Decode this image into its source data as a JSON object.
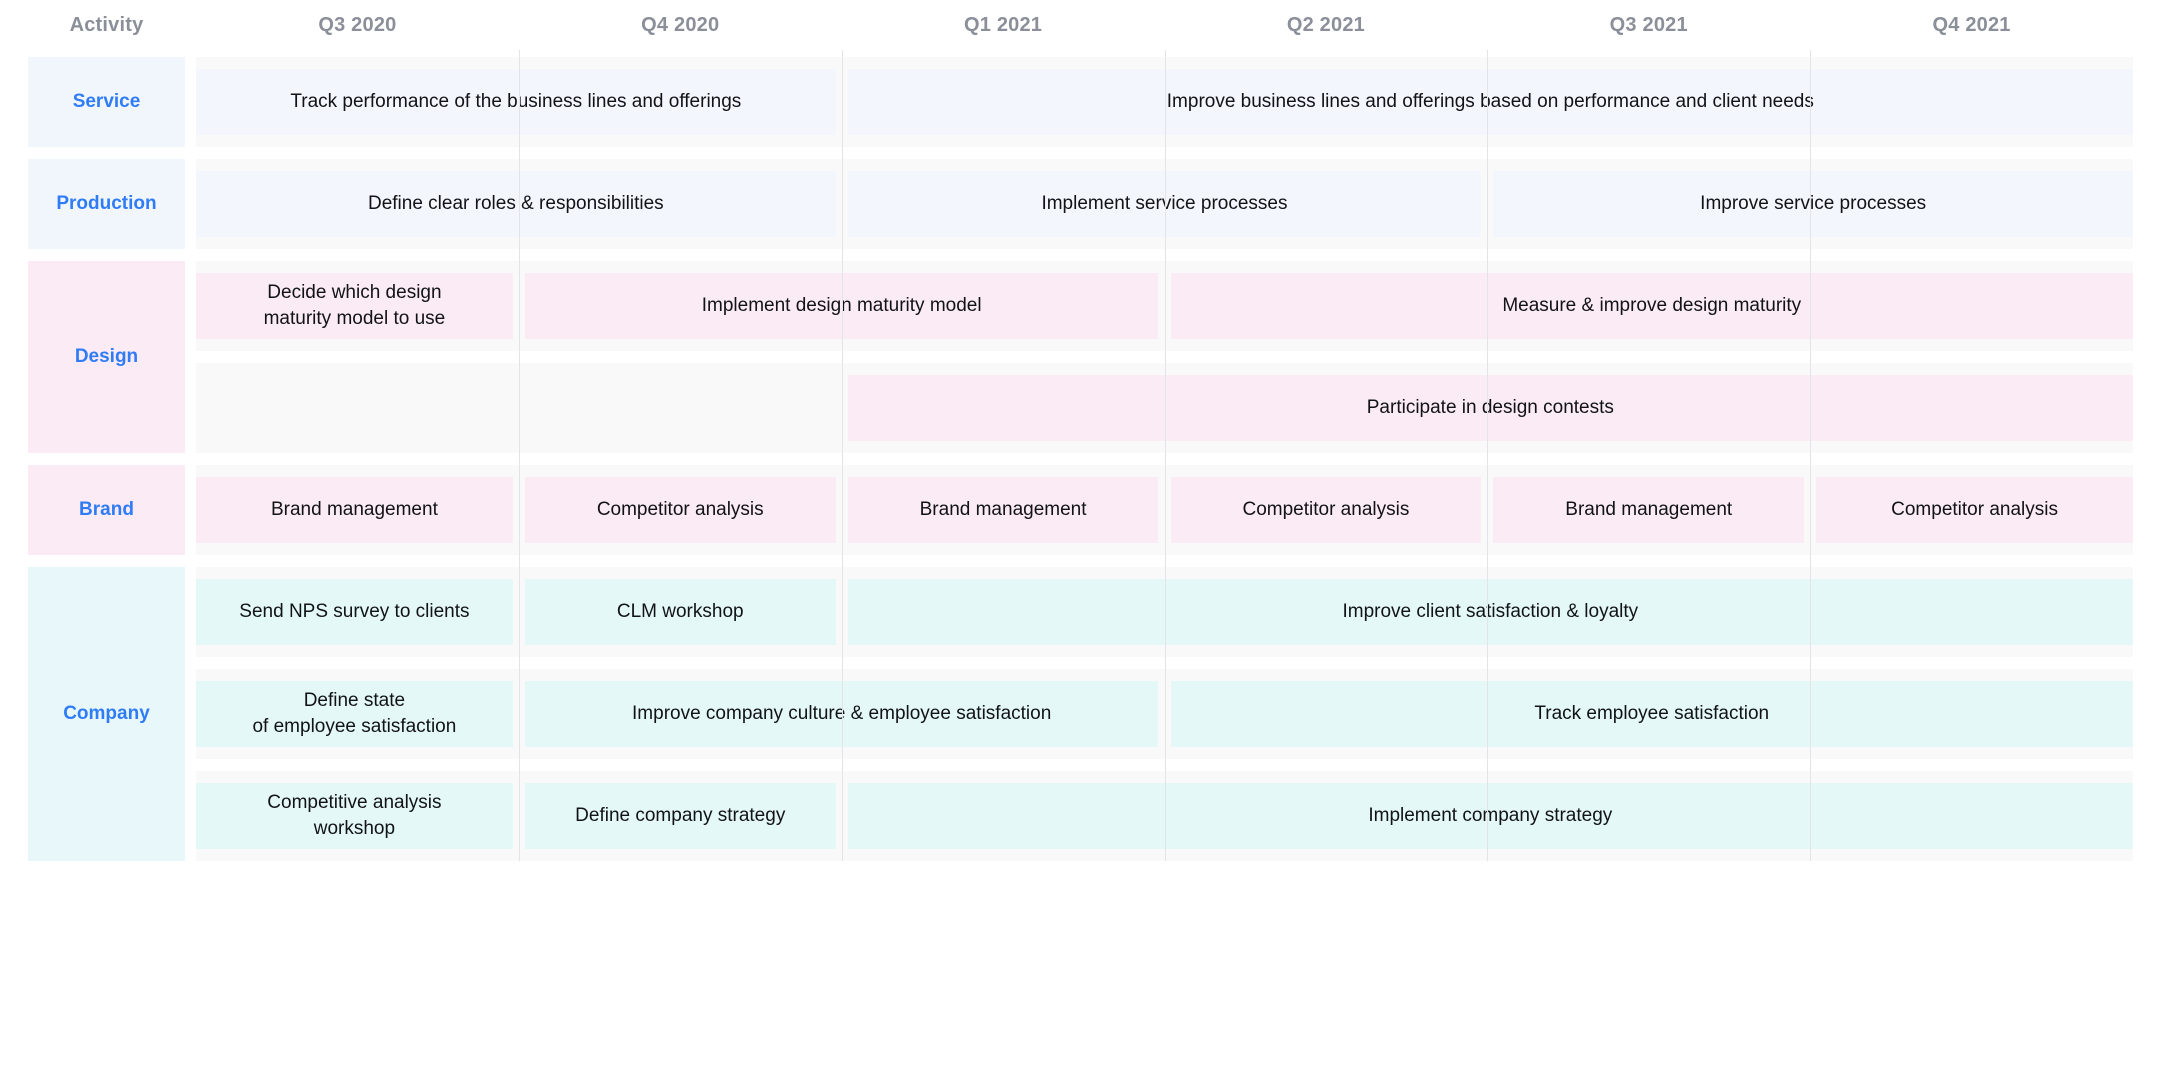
{
  "header": {
    "activity_label": "Activity",
    "quarters": [
      "Q3 2020",
      "Q4 2020",
      "Q1 2021",
      "Q2 2021",
      "Q3 2021",
      "Q4 2021"
    ]
  },
  "colors": {
    "accent_label": "#2f7cf6",
    "header_text": "#8a8f99",
    "bar_blue": "#f3f6fc",
    "bar_pink": "#fbebf4",
    "bar_teal": "#e5f8f8",
    "track": "#f9f9fa",
    "divider": "#e3e4e8",
    "bar_text": "#111317",
    "background": "#ffffff"
  },
  "chart_data": {
    "type": "table",
    "title": "",
    "xlabel": "",
    "ylabel": "",
    "categories": [
      "Q3 2020",
      "Q4 2020",
      "Q1 2021",
      "Q2 2021",
      "Q3 2021",
      "Q4 2021"
    ],
    "groups": [
      {
        "label": "Service",
        "theme": "blue",
        "lanes": [
          [
            {
              "text": "Track performance of the business lines and offerings",
              "start": 0,
              "end": 2
            },
            {
              "text": "Improve business lines and offerings based on performance and client needs",
              "start": 2,
              "end": 6
            }
          ]
        ]
      },
      {
        "label": "Production",
        "theme": "blue",
        "lanes": [
          [
            {
              "text": "Define clear roles & responsibilities",
              "start": 0,
              "end": 2
            },
            {
              "text": "Implement service processes",
              "start": 2,
              "end": 4
            },
            {
              "text": "Improve service processes",
              "start": 4,
              "end": 6
            }
          ]
        ]
      },
      {
        "label": "Design",
        "theme": "pink",
        "lanes": [
          [
            {
              "text": "Decide which design\nmaturity model to use",
              "start": 0,
              "end": 1
            },
            {
              "text": "Implement design maturity model",
              "start": 1,
              "end": 3
            },
            {
              "text": "Measure & improve design maturity",
              "start": 3,
              "end": 6
            }
          ],
          [
            {
              "text": "Participate in design contests",
              "start": 2,
              "end": 6
            }
          ]
        ]
      },
      {
        "label": "Brand",
        "theme": "pink",
        "lanes": [
          [
            {
              "text": "Brand management",
              "start": 0,
              "end": 1
            },
            {
              "text": "Competitor analysis",
              "start": 1,
              "end": 2
            },
            {
              "text": "Brand management",
              "start": 2,
              "end": 3
            },
            {
              "text": "Competitor analysis",
              "start": 3,
              "end": 4
            },
            {
              "text": "Brand management",
              "start": 4,
              "end": 5
            },
            {
              "text": "Competitor analysis",
              "start": 5,
              "end": 6
            }
          ]
        ]
      },
      {
        "label": "Company",
        "theme": "teal",
        "lanes": [
          [
            {
              "text": "Send NPS survey to clients",
              "start": 0,
              "end": 1
            },
            {
              "text": "CLM workshop",
              "start": 1,
              "end": 2
            },
            {
              "text": "Improve client satisfaction & loyalty",
              "start": 2,
              "end": 6
            }
          ],
          [
            {
              "text": "Define state\nof employee satisfaction",
              "start": 0,
              "end": 1
            },
            {
              "text": "Improve company culture & employee satisfaction",
              "start": 1,
              "end": 3
            },
            {
              "text": "Track employee satisfaction",
              "start": 3,
              "end": 6
            }
          ],
          [
            {
              "text": "Competitive analysis\nworkshop",
              "start": 0,
              "end": 1
            },
            {
              "text": "Define company strategy",
              "start": 1,
              "end": 2
            },
            {
              "text": "Implement company strategy",
              "start": 2,
              "end": 6
            }
          ]
        ]
      }
    ]
  }
}
